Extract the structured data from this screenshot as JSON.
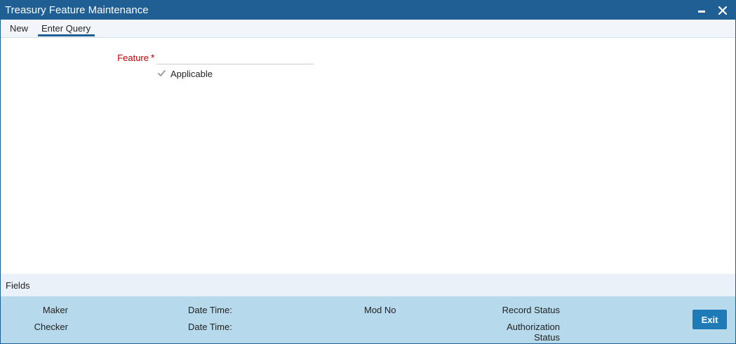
{
  "window": {
    "title": "Treasury Feature Maintenance"
  },
  "menu": {
    "items": [
      {
        "label": "New"
      },
      {
        "label": "Enter Query",
        "active": true
      }
    ]
  },
  "form": {
    "feature_label": "Feature",
    "required_marker": "*",
    "feature_value": "",
    "applicable_label": "Applicable",
    "applicable_checked": true
  },
  "fields_section": {
    "label": "Fields"
  },
  "audit": {
    "maker": "Maker",
    "date_time_1": "Date Time:",
    "mod_no": "Mod No",
    "record_status": "Record Status",
    "checker": "Checker",
    "date_time_2": "Date Time:",
    "authorization_status_line1": "Authorization",
    "authorization_status_line2": "Status"
  },
  "buttons": {
    "exit": "Exit"
  },
  "colors": {
    "titlebar": "#1f5f94",
    "required": "#c00000",
    "audit_bg": "#b7d9ec",
    "exit_bg": "#1f7ab8"
  },
  "icons": {
    "minimize": "minimize-icon",
    "close": "close-icon",
    "checkbox": "checkmark-icon"
  }
}
